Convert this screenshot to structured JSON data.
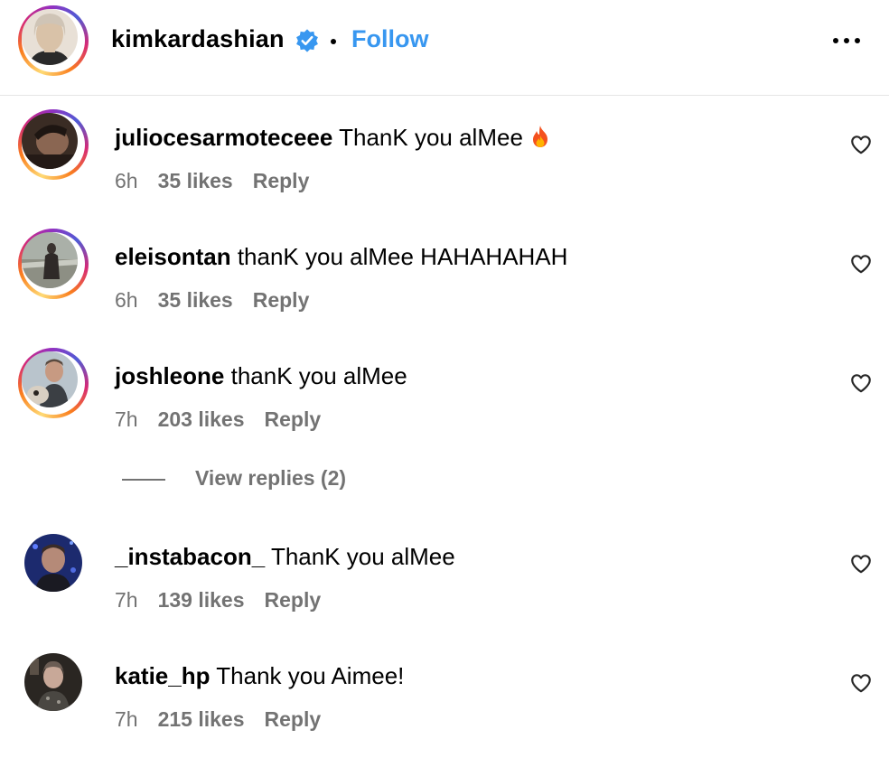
{
  "header": {
    "username": "kimkardashian",
    "follow_label": "Follow"
  },
  "comments": [
    {
      "username": "juliocesarmoteceee",
      "text": "ThanK you alMee",
      "emoji": "fire",
      "time": "6h",
      "likes": "35 likes",
      "reply": "Reply",
      "ring": true
    },
    {
      "username": "eleisontan",
      "text": "thanK you alMee HAHAHAHAH",
      "time": "6h",
      "likes": "35 likes",
      "reply": "Reply",
      "ring": true
    },
    {
      "username": "joshleone",
      "text": "thanK you alMee",
      "time": "7h",
      "likes": "203 likes",
      "reply": "Reply",
      "ring": true
    },
    {
      "username": "_instabacon_",
      "text": "ThanK you alMee",
      "time": "7h",
      "likes": "139 likes",
      "reply": "Reply",
      "ring": false
    },
    {
      "username": "katie_hp",
      "text": "Thank you Aimee!",
      "time": "7h",
      "likes": "215 likes",
      "reply": "Reply",
      "ring": false
    }
  ],
  "view_replies": {
    "label": "View replies (2)"
  },
  "icons": {
    "verified": "verified-badge-icon",
    "more": "more-options-icon",
    "heart": "heart-outline-icon",
    "fire": "fire-emoji-icon"
  },
  "colors": {
    "accent": "#3897f0",
    "secondary_text": "#737373",
    "divider": "#e6e6e6"
  }
}
